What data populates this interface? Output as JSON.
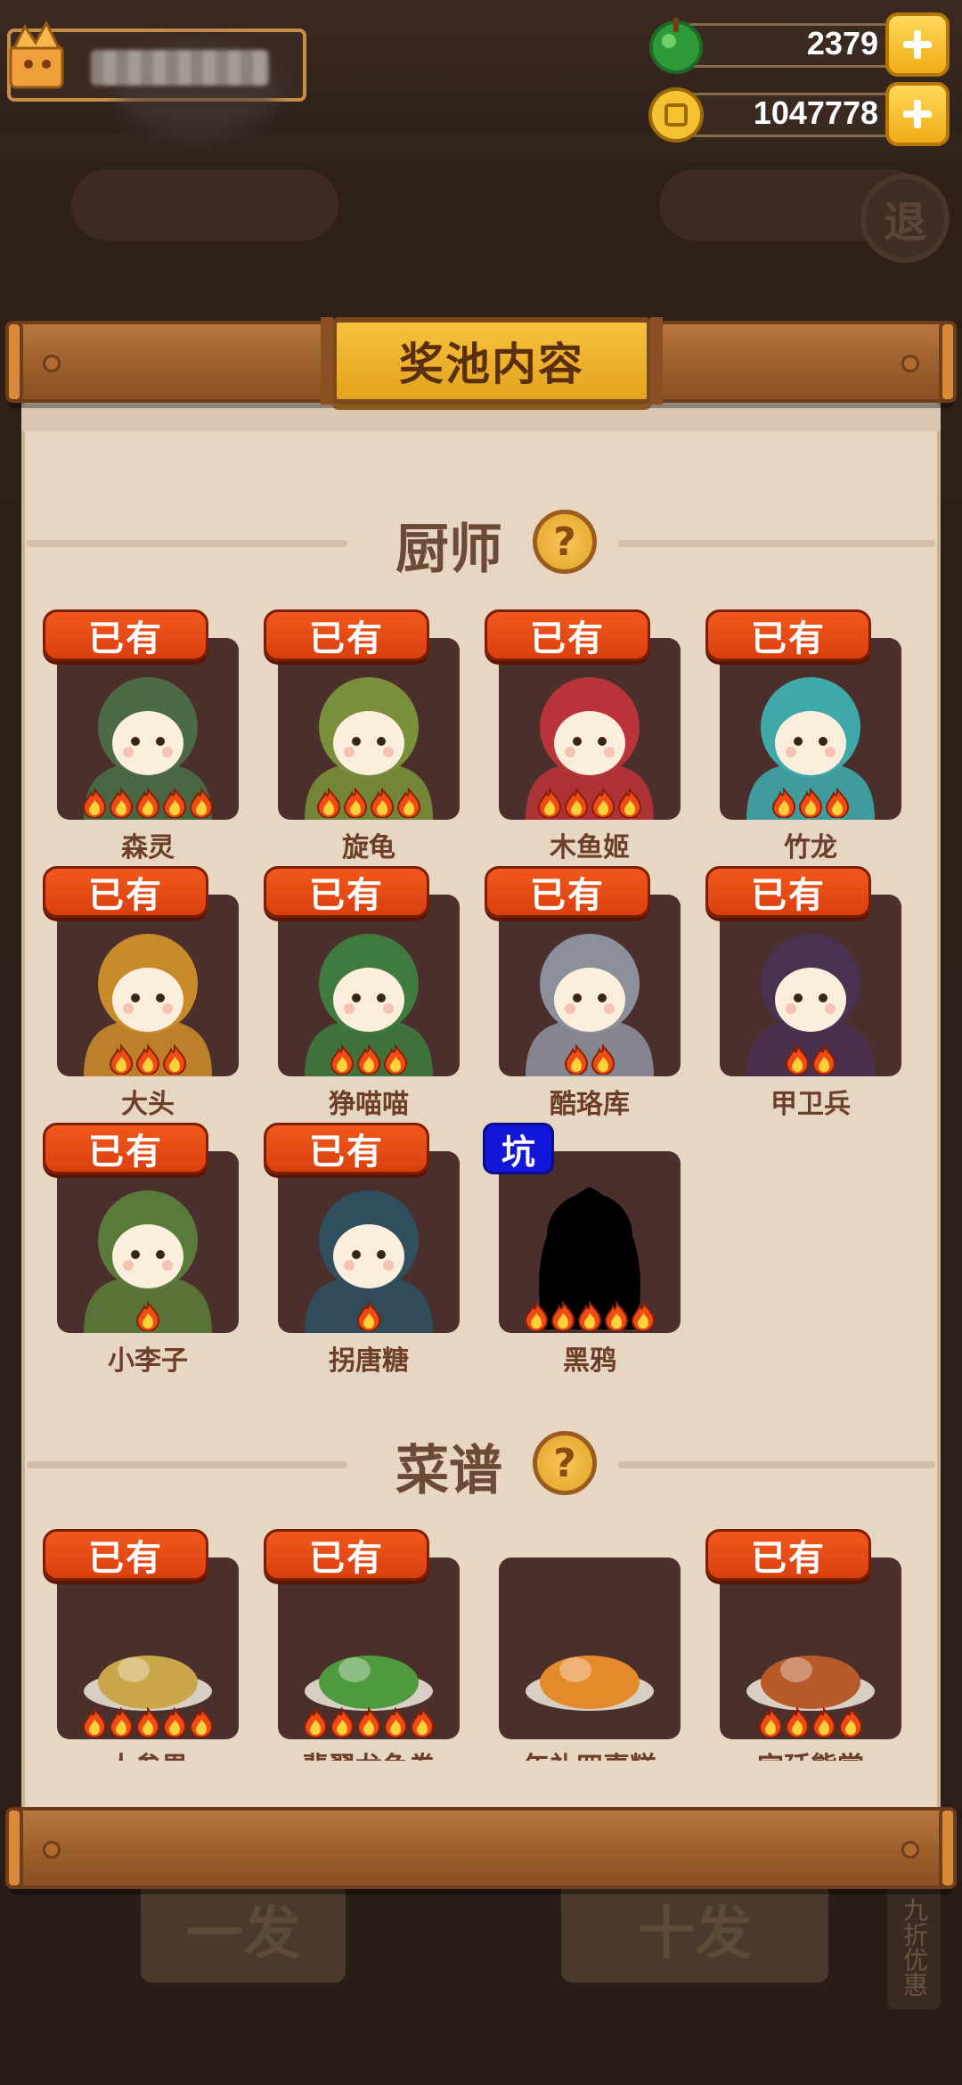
{
  "hud": {
    "jade": "2379",
    "coins": "1047778"
  },
  "background": {
    "exit_label": "退",
    "btn_left": "一发",
    "btn_right": "十发",
    "side_tag": "九折优惠"
  },
  "modal": {
    "title": "奖池内容",
    "sections": {
      "chefs": "厨师",
      "recipes": "菜谱"
    },
    "help_glyph": "?",
    "owned_label": "已有",
    "hole_label": "坑"
  },
  "chefs": [
    {
      "name": "森灵",
      "owned": true,
      "stars": 5,
      "color": "#4a6b44"
    },
    {
      "name": "旋龟",
      "owned": true,
      "stars": 4,
      "color": "#7a8f3a"
    },
    {
      "name": "木鱼姬",
      "owned": true,
      "stars": 4,
      "color": "#b8333a"
    },
    {
      "name": "竹龙",
      "owned": true,
      "stars": 3,
      "color": "#3fa8a8"
    },
    {
      "name": "大头",
      "owned": true,
      "stars": 3,
      "color": "#c98a2a"
    },
    {
      "name": "狰喵喵",
      "owned": true,
      "stars": 3,
      "color": "#3f7a3f"
    },
    {
      "name": "酷珞库",
      "owned": true,
      "stars": 2,
      "color": "#8c8e9a"
    },
    {
      "name": "甲卫兵",
      "owned": true,
      "stars": 2,
      "color": "#4a3150"
    },
    {
      "name": "小李子",
      "owned": true,
      "stars": 1,
      "color": "#5a7a3a"
    },
    {
      "name": "拐唐糖",
      "owned": true,
      "stars": 1,
      "color": "#2f4f5e"
    },
    {
      "name": "黑鸦",
      "owned": false,
      "hole": true,
      "stars": 5,
      "color": "#000000"
    }
  ],
  "recipes": [
    {
      "name": "人参果",
      "owned": true,
      "stars": 5,
      "color": "#c9a64a"
    },
    {
      "name": "翡翠龙鱼卷",
      "owned": true,
      "stars": 5,
      "color": "#4f9a3f"
    },
    {
      "name": "年礼四喜糕",
      "owned": false,
      "stars": 0,
      "color": "#e58a2a"
    },
    {
      "name": "宫廷熊掌",
      "owned": true,
      "stars": 4,
      "color": "#b65a28"
    }
  ]
}
